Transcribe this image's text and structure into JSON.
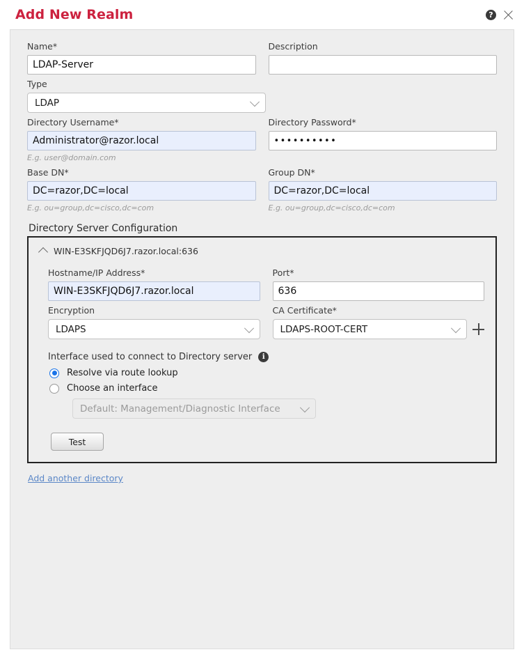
{
  "dialog": {
    "title": "Add New Realm",
    "help_icon": "help-circle-icon",
    "close_icon": "close-icon"
  },
  "form": {
    "name": {
      "label": "Name*",
      "value": "LDAP-Server",
      "placeholder": ""
    },
    "description": {
      "label": "Description",
      "value": "",
      "placeholder": ""
    },
    "type": {
      "label": "Type",
      "value": "LDAP"
    },
    "directory_username": {
      "label": "Directory Username*",
      "value": "Administrator@razor.local",
      "hint": "E.g. user@domain.com"
    },
    "directory_password": {
      "label": "Directory Password*",
      "value": "••••••••••"
    },
    "base_dn": {
      "label": "Base DN*",
      "value": "DC=razor,DC=local",
      "hint": "E.g. ou=group,dc=cisco,dc=com"
    },
    "group_dn": {
      "label": "Group DN*",
      "value": "DC=razor,DC=local",
      "hint": "E.g. ou=group,dc=cisco,dc=com"
    }
  },
  "directory_server": {
    "section_title": "Directory Server Configuration",
    "collapse_icon": "chevron-up-icon",
    "server_label": "WIN-E3SKFJQD6J7.razor.local:636",
    "hostname": {
      "label": "Hostname/IP Address*",
      "value": "WIN-E3SKFJQD6J7.razor.local"
    },
    "port": {
      "label": "Port*",
      "value": "636"
    },
    "encryption": {
      "label": "Encryption",
      "value": "LDAPS"
    },
    "ca_certificate": {
      "label": "CA Certificate*",
      "value": "LDAPS-ROOT-CERT",
      "add_icon": "plus-icon"
    },
    "interface": {
      "label": "Interface used to connect to Directory server",
      "info_icon": "info-icon",
      "option_route_lookup": "Resolve via route lookup",
      "option_choose_interface": "Choose an interface",
      "selected": "Resolve via route lookup",
      "interface_select_value": "Default: Management/Diagnostic Interface"
    },
    "test_button": "Test"
  },
  "footer": {
    "add_another_directory": "Add another directory"
  },
  "colors": {
    "title_red": "#cc223f",
    "panel_bg": "#eeeeee",
    "autofill_bg": "#e9effd",
    "radio_blue": "#1a73e8",
    "link_blue": "#5b87c7",
    "server_box_border": "#222222"
  }
}
